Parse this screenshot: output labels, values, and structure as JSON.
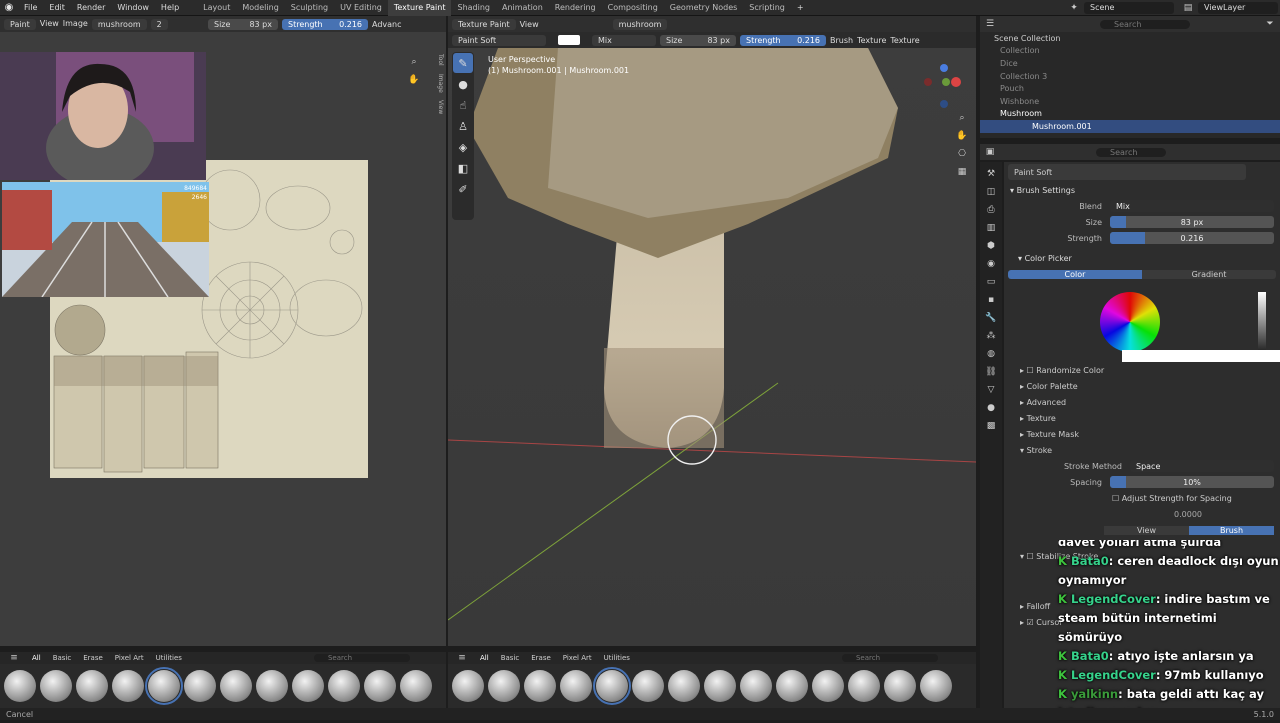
{
  "topbar": {
    "menus": [
      "File",
      "Edit",
      "Render",
      "Window",
      "Help"
    ],
    "workspaces": [
      "Layout",
      "Modeling",
      "Sculpting",
      "UV Editing",
      "Texture Paint",
      "Shading",
      "Animation",
      "Rendering",
      "Compositing",
      "Geometry Nodes",
      "Scripting"
    ],
    "active_workspace": "Texture Paint",
    "scene": "Scene",
    "view_layer": "ViewLayer",
    "plus": "+"
  },
  "left_header": {
    "mode": "Paint",
    "view": "View",
    "image": "Image",
    "image_name": "mushroom",
    "users": "2",
    "size_label": "Size",
    "size_value": "83 px",
    "strength_label": "Strength",
    "strength_value": "0.216",
    "advanced": "Advanc",
    "cat_all": "All",
    "cat_basic": "Basic",
    "cat_erase": "Erase",
    "cat_pixel": "Pixel Art",
    "cat_util": "Utilities",
    "search_ph": "Search",
    "side_tabs": [
      "Tool",
      "Image",
      "View"
    ]
  },
  "viewport_header": {
    "mode": "Texture Paint",
    "view": "View",
    "object": "mushroom",
    "brush": "Paint Soft",
    "blend": "Mix",
    "size_label": "Size",
    "size_value": "83 px",
    "strength_label": "Strength",
    "strength_value": "0.216",
    "brush_menu": "Brush",
    "texture_menu": "Texture",
    "texture_menu2": "Texture",
    "perspective": "User Perspective",
    "object_path": "(1) Mushroom.001 | Mushroom.001",
    "cat_all": "All",
    "cat_basic": "Basic",
    "cat_erase": "Erase",
    "cat_pixel": "Pixel Art",
    "cat_util": "Utilities",
    "search_ph": "Search"
  },
  "outliner": {
    "search_ph": "Search",
    "root": "Scene Collection",
    "items": [
      "Collection",
      "Dice",
      "Collection 3",
      "Pouch",
      "Wishbone",
      "Mushroom",
      "Mushroom.001"
    ]
  },
  "properties": {
    "search_ph": "Search",
    "brush_name": "Paint Soft",
    "brush_settings": "Brush Settings",
    "blend_label": "Blend",
    "blend_value": "Mix",
    "size_label": "Size",
    "size_value": "83 px",
    "size_fill": 0.1,
    "strength_label": "Strength",
    "strength_value": "0.216",
    "strength_fill": 0.216,
    "color_picker": "Color Picker",
    "color_tab": "Color",
    "gradient_tab": "Gradient",
    "randomize": "Randomize Color",
    "sections": [
      "Color Palette",
      "Advanced",
      "Texture",
      "Texture Mask",
      "Stroke"
    ],
    "stroke_method_label": "Stroke Method",
    "stroke_method_value": "Space",
    "spacing_label": "Spacing",
    "spacing_value": "10%",
    "adjust_strength": "Adjust Strength for Spacing",
    "jitter_value": "0.0000",
    "view_tab": "View",
    "brush_tab": "Brush",
    "stabilize": "Stabilize Stroke",
    "falloff": "Falloff",
    "cursor": "Cursor"
  },
  "chat": {
    "overflow_line": "davet yolları atma şuirda",
    "messages": [
      {
        "user": "Bata0",
        "text": ": ceren deadlock dışı oyun oynamıyor"
      },
      {
        "user": "LegendCover",
        "text": ": indire bastım ve steam bütün internetimi sömürüyo"
      },
      {
        "user": "Bata0",
        "text": ": atıyo işte anlarsın ya"
      },
      {
        "user": "LegendCover",
        "text": ": 97mb kullanıyo"
      },
      {
        "user": "yalkinn",
        "text": ": bata geldi attı kaç ay istedim senden"
      }
    ]
  },
  "game_hud": {
    "score": "849684",
    "coins": "2646"
  },
  "status": {
    "left": "Cancel",
    "right": "5.1.0"
  },
  "colors": {
    "accent": "#4772b3",
    "bg": "#1d1d1d",
    "panel": "#303030"
  }
}
